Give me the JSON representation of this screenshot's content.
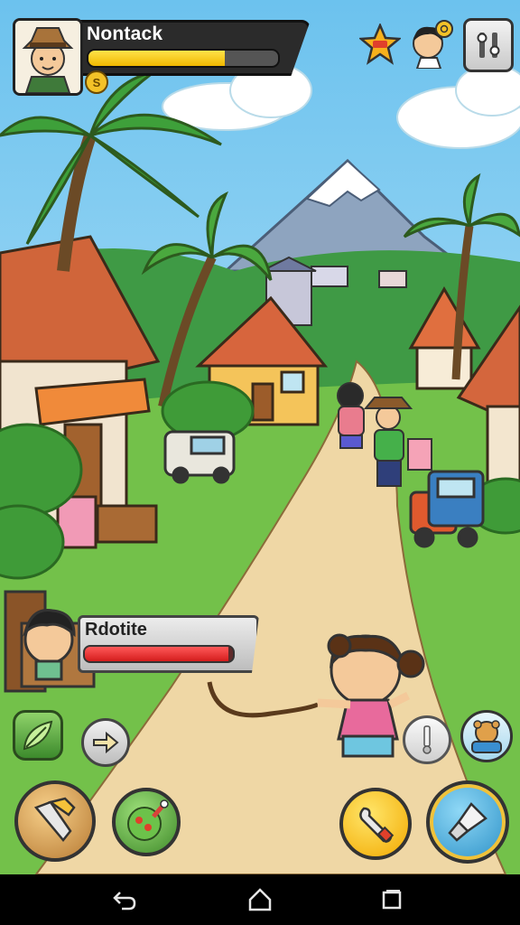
{
  "player": {
    "name": "Nontack",
    "xp_progress": 0.72,
    "currency_symbol": "S"
  },
  "npc": {
    "name": "Rdotite",
    "health_progress": 0.97
  },
  "icons": {
    "top_right": [
      "star-badge-icon",
      "friend-avatar-icon",
      "settings-tools-icon"
    ],
    "left_actions": [
      "leaf-skill-icon",
      "arrow-right-icon"
    ],
    "bottom_actions": [
      "shovel-icon",
      "salad-bowl-icon",
      "wrench-icon",
      "tool-brush-icon"
    ],
    "right_actions": [
      "glass-bottle-icon",
      "pet-helper-icon"
    ],
    "nav": [
      "back-icon",
      "home-icon",
      "recents-icon"
    ]
  },
  "colors": {
    "xp_bar": "#f5c400",
    "health_bar": "#e02424",
    "sky": "#8fd0f0",
    "grass": "#6fbf45",
    "path": "#eed7a6"
  }
}
